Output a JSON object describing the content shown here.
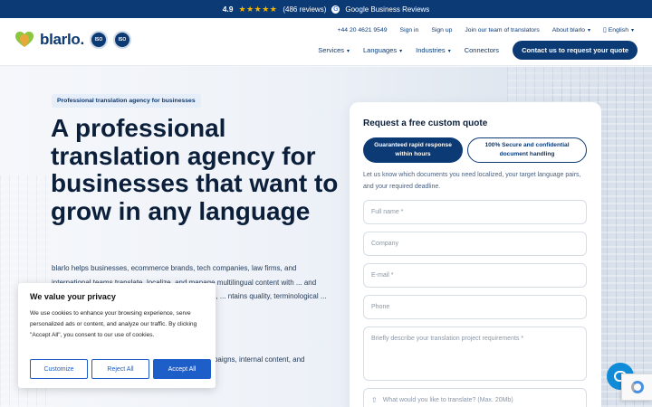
{
  "topbar": {
    "rating": "4.9",
    "stars": "★★★★★",
    "reviews": "(486 reviews)",
    "google_label": "Google Business Reviews"
  },
  "header": {
    "logo_text": "blarlo.",
    "iso_badges": [
      "ISO",
      "ISO"
    ],
    "utility_nav": {
      "phone": "+44 20 4621 9549",
      "signin": "Sign in",
      "signup": "Sign up",
      "join": "Join our team of translators",
      "about": "About blarlo",
      "language": "English"
    },
    "main_nav": {
      "services": "Services",
      "languages": "Languages",
      "industries": "Industries",
      "connectors": "Connectors",
      "cta": "Contact us to request your quote"
    }
  },
  "hero": {
    "badge": "Professional translation agency for businesses",
    "title": "A professional translation agency for businesses that want to grow in any language",
    "body": "blarlo helps businesses, ecommerce brands, tech companies, law firms, and international teams translate, localize, and manage multilingual content with ... and specialized review. ... ation across multiple markets, ... ntains quality, terminological ... all content.",
    "list": "... anguage, market, ... software, meetings, campaigns, internal content, and international communication."
  },
  "cookie": {
    "title": "We value your privacy",
    "text": "We use cookies to enhance your browsing experience, serve personalized ads or content, and analyze our traffic. By clicking \"Accept All\", you consent to our use of cookies.",
    "customize": "Customize",
    "reject": "Reject All",
    "accept": "Accept All"
  },
  "quote": {
    "title": "Request a free custom quote",
    "pill_active": "Guaranteed rapid response within hours",
    "pill_inactive": "100% Secure and confidential document handling",
    "description": "Let us know which documents you need localized, your target language pairs, and your required deadline.",
    "fields": {
      "full_name": "Full name *",
      "company": "Company",
      "email": "E-mail *",
      "phone": "Phone",
      "project": "Briefly describe your translation project requirements *",
      "upload": "What would you like to translate? (Max. 20Mb)"
    }
  },
  "colors": {
    "primary": "#0b3a75",
    "star": "#f5b400",
    "cookie_button": "#1e5ec8",
    "chat": "#0f8bd8"
  }
}
